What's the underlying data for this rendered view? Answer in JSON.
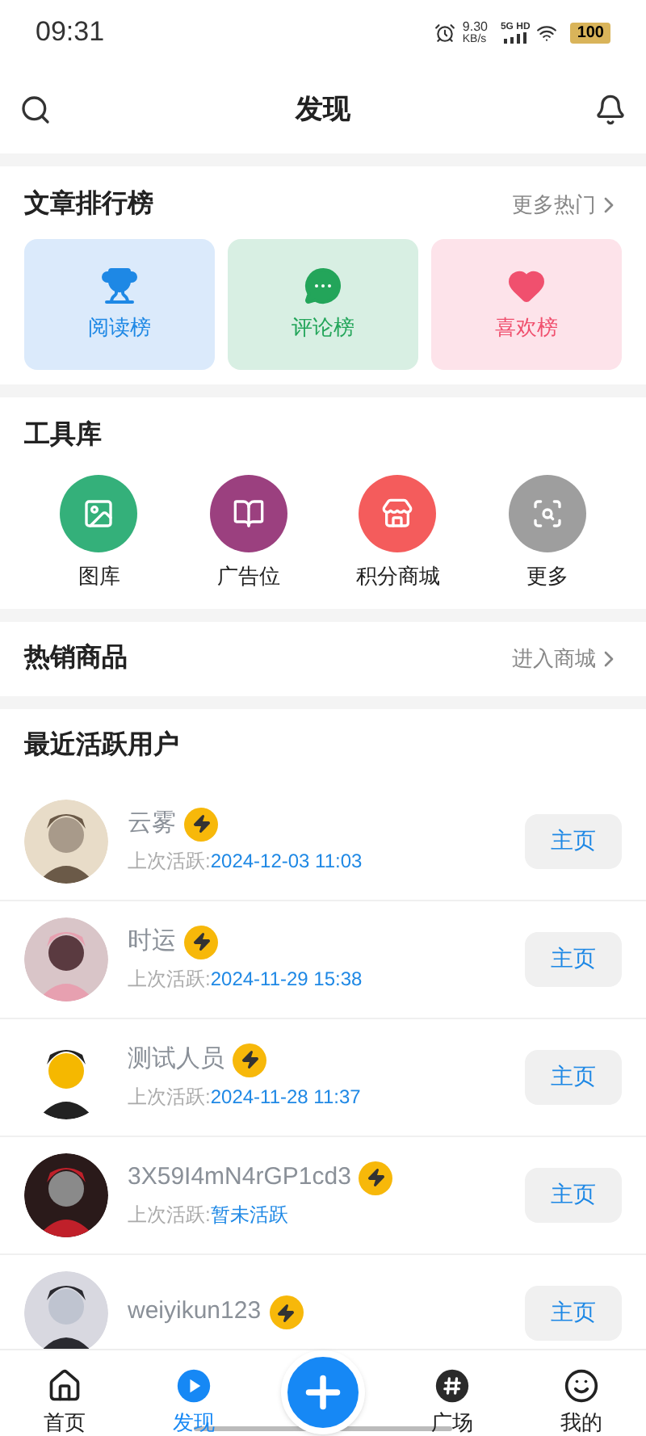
{
  "status_bar": {
    "time": "09:31",
    "net_speed": "9.30",
    "net_unit": "KB/s",
    "network": "5G HD",
    "battery": "100"
  },
  "header": {
    "title": "发现"
  },
  "ranking": {
    "title": "文章排行榜",
    "more": "更多热门",
    "items": [
      {
        "label": "阅读榜",
        "kind": "trophy"
      },
      {
        "label": "评论榜",
        "kind": "chat"
      },
      {
        "label": "喜欢榜",
        "kind": "heart"
      }
    ]
  },
  "tools": {
    "title": "工具库",
    "items": [
      {
        "label": "图库",
        "kind": "gallery"
      },
      {
        "label": "广告位",
        "kind": "book"
      },
      {
        "label": "积分商城",
        "kind": "store"
      },
      {
        "label": "更多",
        "kind": "more"
      }
    ]
  },
  "hot_goods": {
    "title": "热销商品",
    "more": "进入商城"
  },
  "active_users": {
    "title": "最近活跃用户",
    "users": [
      {
        "name": "云雾",
        "last_active_label": "上次活跃:",
        "last_active": "2024-12-03 11:03",
        "button": "主页"
      },
      {
        "name": "时运",
        "last_active_label": "上次活跃:",
        "last_active": "2024-11-29 15:38",
        "button": "主页"
      },
      {
        "name": "测试人员",
        "last_active_label": "上次活跃:",
        "last_active": "2024-11-28 11:37",
        "button": "主页"
      },
      {
        "name": "3X59I4mN4rGP1cd3",
        "last_active_label": "上次活跃:",
        "last_active": "暂未活跃",
        "button": "主页"
      },
      {
        "name": "weiyikun123",
        "button": "主页"
      }
    ]
  },
  "tab_bar": {
    "items": [
      {
        "label": "首页",
        "kind": "home",
        "selected": false
      },
      {
        "label": "发现",
        "kind": "discover",
        "selected": true
      },
      {
        "kind": "add"
      },
      {
        "label": "广场",
        "kind": "square",
        "selected": false
      },
      {
        "label": "我的",
        "kind": "me",
        "selected": false
      }
    ]
  }
}
